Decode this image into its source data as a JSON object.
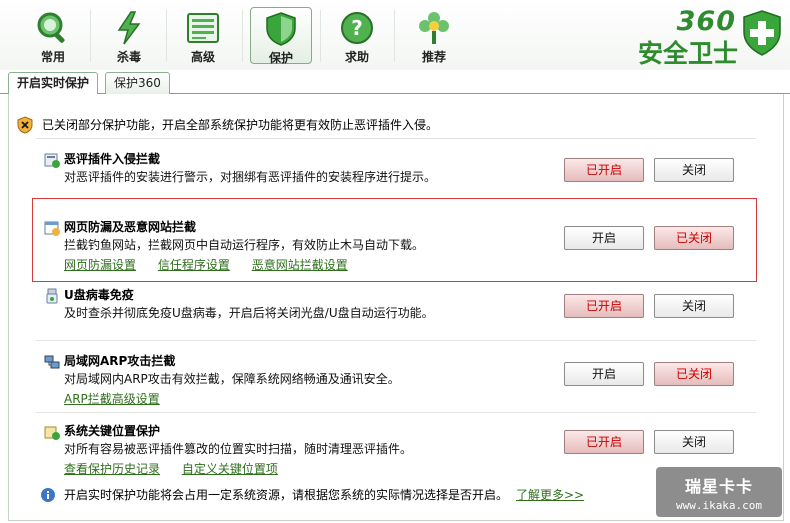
{
  "toolbar": {
    "items": [
      {
        "label": "常用",
        "icon": "magnifier-icon"
      },
      {
        "label": "杀毒",
        "icon": "lightning-icon"
      },
      {
        "label": "高级",
        "icon": "panel-icon"
      },
      {
        "label": "保护",
        "icon": "shield-icon"
      },
      {
        "label": "求助",
        "icon": "question-icon"
      },
      {
        "label": "推荐",
        "icon": "flower-icon"
      }
    ],
    "active_index": 3
  },
  "logo": {
    "top": "360",
    "bottom": "安全卫士"
  },
  "tabs": [
    {
      "label": "开启实时保护"
    },
    {
      "label": "保护360"
    }
  ],
  "notice": {
    "text": "已关闭部分保护功能，开启全部系统保护功能将更有效防止恶评插件入侵。"
  },
  "sections": [
    {
      "title": "恶评插件入侵拦截",
      "desc": "对恶评插件的安装进行警示，对捆绑有恶评插件的安装程序进行提示。",
      "links": [],
      "left_button": "已开启",
      "right_button": "关闭",
      "state": "on"
    },
    {
      "title": "网页防漏及恶意网站拦截",
      "desc": "拦截钓鱼网站，拦截网页中自动运行程序，有效防止木马自动下载。",
      "links": [
        "网页防漏设置",
        "信任程序设置",
        "恶意网站拦截设置"
      ],
      "left_button": "开启",
      "right_button": "已关闭",
      "state": "off"
    },
    {
      "title": "U盘病毒免疫",
      "desc": "及时查杀并彻底免疫U盘病毒，开启后将关闭光盘/U盘自动运行功能。",
      "links": [],
      "left_button": "已开启",
      "right_button": "关闭",
      "state": "on"
    },
    {
      "title": "局域网ARP攻击拦截",
      "desc": "对局域网内ARP攻击有效拦截，保障系统网络畅通及通讯安全。",
      "links": [
        "ARP拦截高级设置"
      ],
      "left_button": "开启",
      "right_button": "已关闭",
      "state": "off"
    },
    {
      "title": "系统关键位置保护",
      "desc": "对所有容易被恶评插件篡改的位置实时扫描，随时清理恶评插件。",
      "links": [
        "查看保护历史记录",
        "自定义关键位置项"
      ],
      "left_button": "已开启",
      "right_button": "关闭",
      "state": "on"
    }
  ],
  "footer": {
    "text": "开启实时保护功能将会占用一定系统资源，请根据您系统的实际情况选择是否开启。",
    "link": "了解更多>>"
  },
  "watermark": {
    "line1": "瑞星卡卡",
    "line2": "www.ikaka.com"
  },
  "colors": {
    "accent": "#2e8b2e",
    "link": "#2f6f1d",
    "on_text": "#cc0000",
    "highlight": "#d63a3a"
  }
}
